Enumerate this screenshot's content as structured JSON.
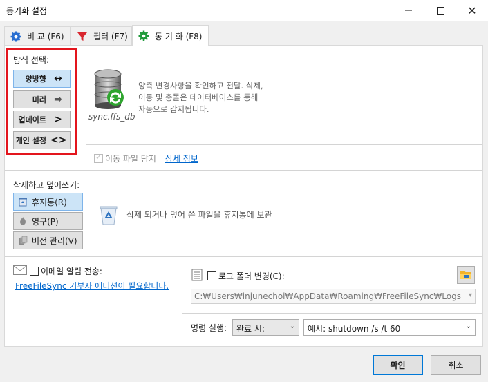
{
  "window": {
    "title": "동기화 설정"
  },
  "tabs": [
    {
      "label": "비 교 (F6)"
    },
    {
      "label": "필터 (F7)"
    },
    {
      "label": "동 기 화 (F8)"
    }
  ],
  "sync": {
    "method_label": "방식 선택:",
    "methods": [
      {
        "label": "양방향",
        "icon": "↔"
      },
      {
        "label": "미러",
        "icon": "➡"
      },
      {
        "label": "업데이트",
        "icon": ">"
      },
      {
        "label": "개인 설정",
        "icon": "<>"
      }
    ],
    "db_name": "sync.ffs_db",
    "description_lines": [
      "양측 변경사항을 확인하고 전달. 삭제,",
      "이동 및 충돌은 데이터베이스를 통해",
      "자동으로 감지됩니다."
    ],
    "detect_moved": "이동 파일 탐지",
    "details_link": "상세 정보"
  },
  "deletion": {
    "label": "삭제하고 덮어쓰기:",
    "options": [
      {
        "label": "휴지통(R)"
      },
      {
        "label": "영구(P)"
      },
      {
        "label": "버전 관리(V)"
      }
    ],
    "description": "삭제 되거나 덮어 쓴 파일을 휴지통에 보관"
  },
  "email": {
    "label": "이메일 알림 전송:",
    "link": "FreeFileSync 기부자 에디션이 필요합니다."
  },
  "log": {
    "label": "로그 폴더 변경(C):",
    "path": "C:₩Users₩injunechoi₩AppData₩Roaming₩FreeFileSync₩Logs"
  },
  "command": {
    "label": "명령 실행:",
    "when": "완료 시:",
    "placeholder": "예시: shutdown /s /t 60"
  },
  "footer": {
    "ok": "확인",
    "cancel": "취소"
  },
  "colors": {
    "highlight_border": "#e3151d",
    "selected_bg": "#cce4f7",
    "link": "#0066cc"
  }
}
